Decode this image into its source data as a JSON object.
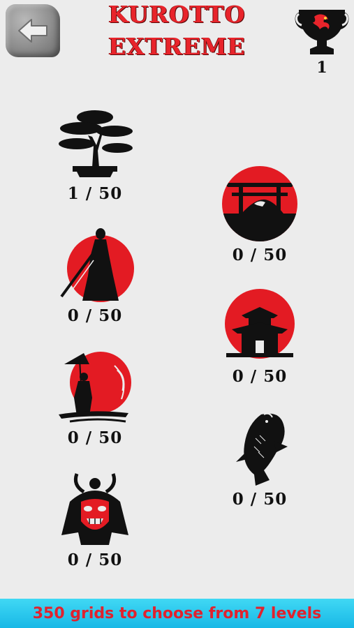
{
  "header": {
    "title_line1": "KUROTTO",
    "title_line2": "EXTREME",
    "trophy_count": "1"
  },
  "levels": [
    {
      "name": "bonsai",
      "progress": "1 / 50"
    },
    {
      "name": "samurai",
      "progress": "0 / 50"
    },
    {
      "name": "umbrella-woman",
      "progress": "0 / 50"
    },
    {
      "name": "samurai-mask",
      "progress": "0 / 50"
    },
    {
      "name": "torii-gate",
      "progress": "0 / 50"
    },
    {
      "name": "pagoda",
      "progress": "0 / 50"
    },
    {
      "name": "koi-fish",
      "progress": "0 / 50"
    }
  ],
  "banner": {
    "text": "350 grids to choose from 7 levels"
  },
  "icons": {
    "back": "back-arrow-icon",
    "trophy": "trophy-icon"
  },
  "colors": {
    "title_red": "#e8242b",
    "sun_red": "#e31b23",
    "banner_bg": "#29c6ee"
  }
}
